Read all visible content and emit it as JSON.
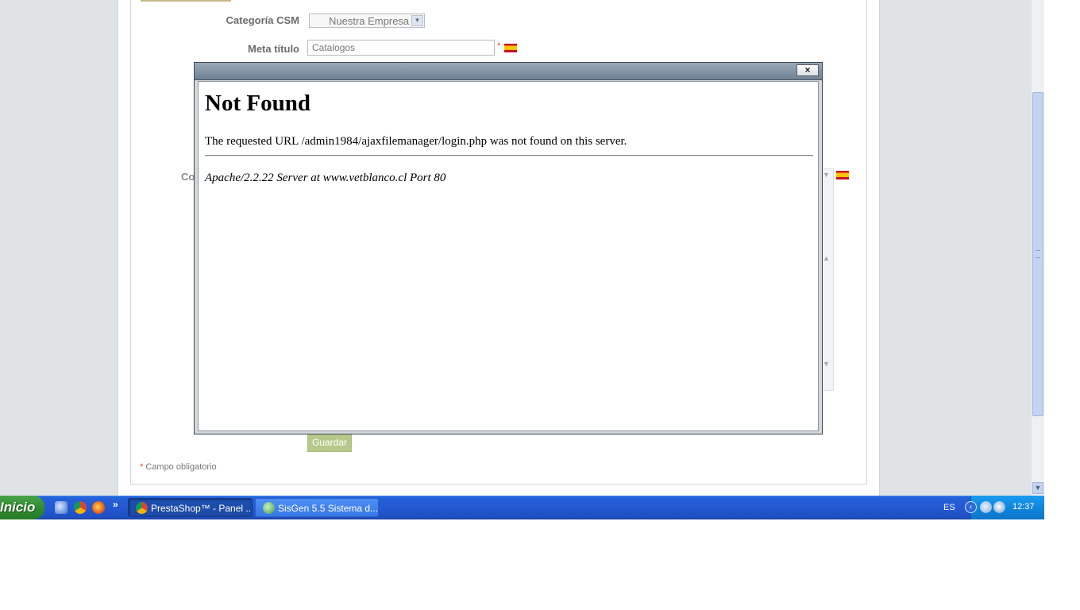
{
  "form": {
    "category_label": "Categoría CSM",
    "category_value": "Nuestra Empresa",
    "meta_title_label": "Meta título",
    "meta_title_value": "Catalogos",
    "required_mark": "*",
    "partial_label": "Co",
    "save_label": "Guardar",
    "footnote_star": "*",
    "footnote_text": "Campo obligatorio"
  },
  "dialog": {
    "close_glyph": "×",
    "heading": "Not Found",
    "message": "The requested URL /admin1984/ajaxfilemanager/login.php was not found on this server.",
    "server_signature": "Apache/2.2.22 Server at www.vetblanco.cl Port 80"
  },
  "taskbar": {
    "start_label": "Inicio",
    "more_glyph": "»",
    "tasks": [
      {
        "label": "PrestaShop™ - Panel ...",
        "icon": "chrome-icon"
      },
      {
        "label": "SisGen 5.5  Sistema d...",
        "icon": "sisgen-icon"
      }
    ],
    "language": "ES",
    "clock": "12:37"
  },
  "colors": {
    "accent_green": "#b7c98a",
    "taskbar_blue": "#2459d2",
    "required_red": "#e6412f"
  }
}
